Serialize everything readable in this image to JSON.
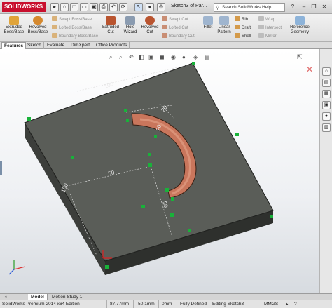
{
  "app": {
    "logo_text": "SOLIDWORKS",
    "document_title": "Sketch3 of Par...",
    "search_placeholder": "Search SolidWorks Help"
  },
  "ribbon": {
    "extruded_boss": "Extruded Boss/Base",
    "revolved_boss": "Revolved Boss/Base",
    "swept_boss": "Swept Boss/Base",
    "lofted_boss": "Lofted Boss/Base",
    "boundary_boss": "Boundary Boss/Base",
    "extruded_cut": "Extruded Cut",
    "hole_wizard": "Hole Wizard",
    "revolved_cut": "Revolved Cut",
    "swept_cut": "Swept Cut",
    "lofted_cut": "Lofted Cut",
    "boundary_cut": "Boundary Cut",
    "fillet": "Fillet",
    "linear_pattern": "Linear Pattern",
    "rib": "Rib",
    "draft": "Draft",
    "shell": "Shell",
    "wrap": "Wrap",
    "intersect": "Intersect",
    "mirror": "Mirror",
    "reference_geometry": "Reference Geometry"
  },
  "tabs": [
    "Features",
    "Sketch",
    "Evaluate",
    "DimXpert",
    "Office Products"
  ],
  "viewport": {
    "dimensions": [
      "100",
      "100",
      "50",
      "50",
      "20",
      "20"
    ],
    "accent_green": "#19b23a",
    "block_top_color": "#5a5d58",
    "cut_color": "#c9765c"
  },
  "bottom_tabs": [
    "Model",
    "Motion Study 1"
  ],
  "status": {
    "edition": "SolidWorks Premium 2014 x64 Edition",
    "x": "87.77mm",
    "y": "-50.1mm",
    "z": "0mm",
    "definition": "Fully Defined",
    "editing": "Editing Sketch3",
    "units": "MMGS"
  }
}
